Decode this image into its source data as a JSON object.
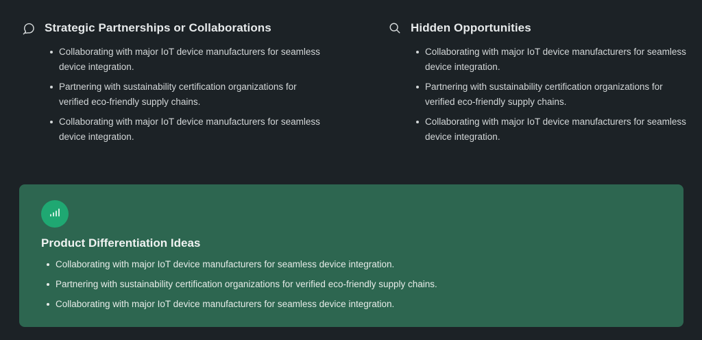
{
  "sections": {
    "partnerships": {
      "icon": "chat-bubble-icon",
      "title": "Strategic Partnerships or Collaborations",
      "items": [
        "Collaborating with major IoT device manufacturers for seamless device integration.",
        "Partnering with sustainability certification organizations for verified eco-friendly supply chains.",
        "Collaborating with major IoT device manufacturers for seamless device integration."
      ]
    },
    "opportunities": {
      "icon": "search-icon",
      "title": "Hidden Opportunities",
      "items": [
        "Collaborating with major IoT device manufacturers for seamless device integration.",
        "Partnering with sustainability certification organizations for verified eco-friendly supply chains.",
        "Collaborating with major IoT device manufacturers for seamless device integration."
      ]
    }
  },
  "card": {
    "icon": "signal-bars-icon",
    "title": "Product Differentiation Ideas",
    "items": [
      "Collaborating with major IoT device manufacturers for seamless device integration.",
      "Partnering with sustainability certification organizations for verified eco-friendly supply chains.",
      "Collaborating with major IoT device manufacturers for seamless device integration."
    ]
  },
  "colors": {
    "background": "#1c2226",
    "card_background": "#2d6650",
    "badge": "#1fa872"
  }
}
